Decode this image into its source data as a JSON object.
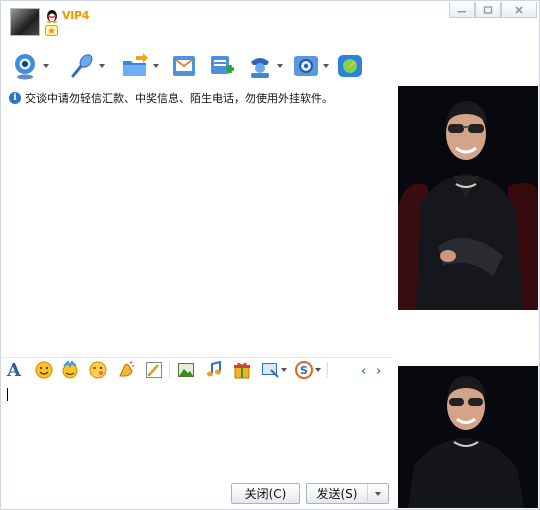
{
  "title_bar": {
    "vip_label": "VIP4",
    "buttons": [
      "minimize",
      "maximize",
      "close"
    ]
  },
  "toolbar": {
    "items": [
      {
        "icon": "webcam-icon",
        "has_dropdown": true
      },
      {
        "icon": "microphone-icon",
        "has_dropdown": true
      },
      {
        "icon": "send-file-icon",
        "has_dropdown": true
      },
      {
        "icon": "mail-icon",
        "has_dropdown": false
      },
      {
        "icon": "add-note-icon",
        "has_dropdown": false
      },
      {
        "icon": "remote-assist-icon",
        "has_dropdown": true
      },
      {
        "icon": "settings-icon",
        "has_dropdown": true
      },
      {
        "icon": "app-launcher-icon",
        "has_dropdown": false
      }
    ]
  },
  "notice": {
    "text": "交谈中请勿轻信汇款、中奖信息、陌生电话，勿使用外挂软件。"
  },
  "format_toolbar": {
    "font_glyph": "A",
    "items": [
      "font-icon",
      "smiley-icon",
      "magic-face-icon",
      "wink-face-icon",
      "vibrate-icon",
      "handwriting-icon",
      "image-icon",
      "music-icon",
      "gift-icon",
      "screenshot-icon",
      "sogou-icon"
    ],
    "nav_prev": "‹",
    "nav_next": "›"
  },
  "actions": {
    "close_label": "关闭(C)",
    "send_label": "发送(S)"
  },
  "colors": {
    "vip": "#f19a00",
    "accent_blue": "#2c74c8",
    "border": "#cdd6e2"
  }
}
